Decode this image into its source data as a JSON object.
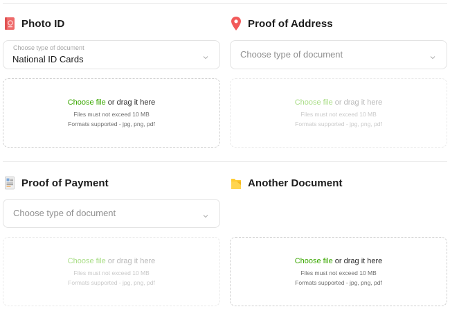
{
  "sections": {
    "photo_id": {
      "title": "Photo ID",
      "select_floating_label": "Choose type of document",
      "select_value": "National ID Cards",
      "drop": {
        "choose": "Choose file",
        "rest": " or drag it here",
        "limit": "Files must not exceed 10 MB",
        "formats": "Formats supported - jpg, png, pdf"
      }
    },
    "proof_of_address": {
      "title": "Proof of Address",
      "select_placeholder": "Choose type of document",
      "drop": {
        "choose": "Choose file",
        "rest": " or drag it here",
        "limit": "Files must not exceed 10 MB",
        "formats": "Formats supported - jpg, png, pdf"
      }
    },
    "proof_of_payment": {
      "title": "Proof of Payment",
      "select_placeholder": "Choose type of document",
      "drop": {
        "choose": "Choose file",
        "rest": " or drag it here",
        "limit": "Files must not exceed 10 MB",
        "formats": "Formats supported - jpg, png, pdf"
      }
    },
    "another_document": {
      "title": "Another Document",
      "drop": {
        "choose": "Choose file",
        "rest": " or drag it here",
        "limit": "Files must not exceed 10 MB",
        "formats": "Formats supported - jpg, png, pdf"
      }
    }
  },
  "icons": {
    "photo_id": "passport-icon",
    "proof_of_address": "location-pin-icon",
    "proof_of_payment": "receipt-icon",
    "another_document": "folder-icon"
  },
  "colors": {
    "link_green": "#3aa700",
    "link_green_disabled": "#a9dd86",
    "pin_red": "#f25a5a",
    "passport_red": "#ee6a6a",
    "folder_yellow": "#ffcc33"
  }
}
